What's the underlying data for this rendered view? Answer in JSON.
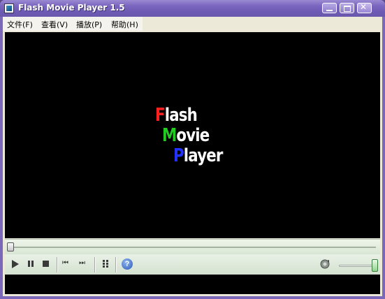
{
  "window": {
    "title": "Flash Movie Player 1.5"
  },
  "menu": [
    "文件(F)",
    "查看(V)",
    "播放(P)",
    "帮助(H)"
  ],
  "logo": [
    {
      "first": "F",
      "rest": "lash",
      "color": "#ff2020"
    },
    {
      "first": "M",
      "rest": "ovie",
      "color": "#22cc22"
    },
    {
      "first": "P",
      "rest": "layer",
      "color": "#2233ff"
    }
  ],
  "controls": {
    "help_glyph": "?",
    "prev_glyph": "⏮",
    "next_glyph": "⏭",
    "volume_level": 1.0,
    "seek_position": 0.0
  }
}
